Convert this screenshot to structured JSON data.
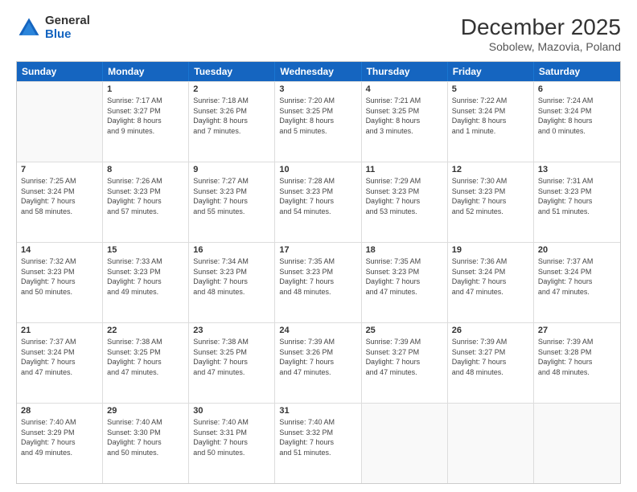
{
  "header": {
    "logo_general": "General",
    "logo_blue": "Blue",
    "month_year": "December 2025",
    "location": "Sobolew, Mazovia, Poland"
  },
  "days_of_week": [
    "Sunday",
    "Monday",
    "Tuesday",
    "Wednesday",
    "Thursday",
    "Friday",
    "Saturday"
  ],
  "weeks": [
    [
      {
        "day": "",
        "info": ""
      },
      {
        "day": "1",
        "info": "Sunrise: 7:17 AM\nSunset: 3:27 PM\nDaylight: 8 hours\nand 9 minutes."
      },
      {
        "day": "2",
        "info": "Sunrise: 7:18 AM\nSunset: 3:26 PM\nDaylight: 8 hours\nand 7 minutes."
      },
      {
        "day": "3",
        "info": "Sunrise: 7:20 AM\nSunset: 3:25 PM\nDaylight: 8 hours\nand 5 minutes."
      },
      {
        "day": "4",
        "info": "Sunrise: 7:21 AM\nSunset: 3:25 PM\nDaylight: 8 hours\nand 3 minutes."
      },
      {
        "day": "5",
        "info": "Sunrise: 7:22 AM\nSunset: 3:24 PM\nDaylight: 8 hours\nand 1 minute."
      },
      {
        "day": "6",
        "info": "Sunrise: 7:24 AM\nSunset: 3:24 PM\nDaylight: 8 hours\nand 0 minutes."
      }
    ],
    [
      {
        "day": "7",
        "info": "Sunrise: 7:25 AM\nSunset: 3:24 PM\nDaylight: 7 hours\nand 58 minutes."
      },
      {
        "day": "8",
        "info": "Sunrise: 7:26 AM\nSunset: 3:23 PM\nDaylight: 7 hours\nand 57 minutes."
      },
      {
        "day": "9",
        "info": "Sunrise: 7:27 AM\nSunset: 3:23 PM\nDaylight: 7 hours\nand 55 minutes."
      },
      {
        "day": "10",
        "info": "Sunrise: 7:28 AM\nSunset: 3:23 PM\nDaylight: 7 hours\nand 54 minutes."
      },
      {
        "day": "11",
        "info": "Sunrise: 7:29 AM\nSunset: 3:23 PM\nDaylight: 7 hours\nand 53 minutes."
      },
      {
        "day": "12",
        "info": "Sunrise: 7:30 AM\nSunset: 3:23 PM\nDaylight: 7 hours\nand 52 minutes."
      },
      {
        "day": "13",
        "info": "Sunrise: 7:31 AM\nSunset: 3:23 PM\nDaylight: 7 hours\nand 51 minutes."
      }
    ],
    [
      {
        "day": "14",
        "info": "Sunrise: 7:32 AM\nSunset: 3:23 PM\nDaylight: 7 hours\nand 50 minutes."
      },
      {
        "day": "15",
        "info": "Sunrise: 7:33 AM\nSunset: 3:23 PM\nDaylight: 7 hours\nand 49 minutes."
      },
      {
        "day": "16",
        "info": "Sunrise: 7:34 AM\nSunset: 3:23 PM\nDaylight: 7 hours\nand 48 minutes."
      },
      {
        "day": "17",
        "info": "Sunrise: 7:35 AM\nSunset: 3:23 PM\nDaylight: 7 hours\nand 48 minutes."
      },
      {
        "day": "18",
        "info": "Sunrise: 7:35 AM\nSunset: 3:23 PM\nDaylight: 7 hours\nand 47 minutes."
      },
      {
        "day": "19",
        "info": "Sunrise: 7:36 AM\nSunset: 3:24 PM\nDaylight: 7 hours\nand 47 minutes."
      },
      {
        "day": "20",
        "info": "Sunrise: 7:37 AM\nSunset: 3:24 PM\nDaylight: 7 hours\nand 47 minutes."
      }
    ],
    [
      {
        "day": "21",
        "info": "Sunrise: 7:37 AM\nSunset: 3:24 PM\nDaylight: 7 hours\nand 47 minutes."
      },
      {
        "day": "22",
        "info": "Sunrise: 7:38 AM\nSunset: 3:25 PM\nDaylight: 7 hours\nand 47 minutes."
      },
      {
        "day": "23",
        "info": "Sunrise: 7:38 AM\nSunset: 3:25 PM\nDaylight: 7 hours\nand 47 minutes."
      },
      {
        "day": "24",
        "info": "Sunrise: 7:39 AM\nSunset: 3:26 PM\nDaylight: 7 hours\nand 47 minutes."
      },
      {
        "day": "25",
        "info": "Sunrise: 7:39 AM\nSunset: 3:27 PM\nDaylight: 7 hours\nand 47 minutes."
      },
      {
        "day": "26",
        "info": "Sunrise: 7:39 AM\nSunset: 3:27 PM\nDaylight: 7 hours\nand 48 minutes."
      },
      {
        "day": "27",
        "info": "Sunrise: 7:39 AM\nSunset: 3:28 PM\nDaylight: 7 hours\nand 48 minutes."
      }
    ],
    [
      {
        "day": "28",
        "info": "Sunrise: 7:40 AM\nSunset: 3:29 PM\nDaylight: 7 hours\nand 49 minutes."
      },
      {
        "day": "29",
        "info": "Sunrise: 7:40 AM\nSunset: 3:30 PM\nDaylight: 7 hours\nand 50 minutes."
      },
      {
        "day": "30",
        "info": "Sunrise: 7:40 AM\nSunset: 3:31 PM\nDaylight: 7 hours\nand 50 minutes."
      },
      {
        "day": "31",
        "info": "Sunrise: 7:40 AM\nSunset: 3:32 PM\nDaylight: 7 hours\nand 51 minutes."
      },
      {
        "day": "",
        "info": ""
      },
      {
        "day": "",
        "info": ""
      },
      {
        "day": "",
        "info": ""
      }
    ]
  ]
}
